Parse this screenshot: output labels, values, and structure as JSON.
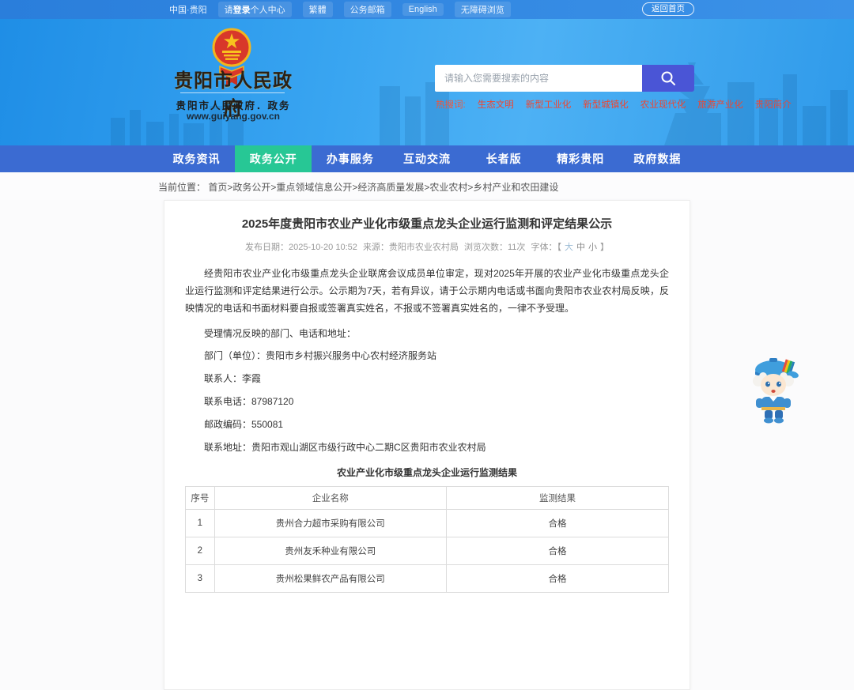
{
  "top_bar": {
    "region": "中国·贵阳",
    "login": {
      "prefix": "请",
      "bold": "登录",
      "suffix": "个人中心"
    },
    "traditional": "繁體",
    "mailbox": "公务邮箱",
    "english": "English",
    "accessibility": "无障碍浏览",
    "return_home": "返回首页"
  },
  "header": {
    "site_name": "贵阳市人民政府",
    "site_subtitle": "贵阳市人民政府．政务",
    "site_url": "www.guiyang.gov.cn",
    "search_placeholder": "请输入您需要搜索的内容",
    "hot_label": "热搜词:",
    "hot_words": [
      "生态文明",
      "新型工业化",
      "新型城镇化",
      "农业现代化",
      "旅游产业化",
      "贵阳简介"
    ]
  },
  "nav": {
    "tabs": [
      {
        "label": "政务资讯"
      },
      {
        "label": "政务公开"
      },
      {
        "label": "办事服务"
      },
      {
        "label": "互动交流"
      },
      {
        "label": "长者版"
      },
      {
        "label": "精彩贵阳"
      },
      {
        "label": "政府数据"
      }
    ],
    "active_tab": "政务公开"
  },
  "breadcrumb": {
    "label": "当前位置：",
    "path": "首页>政务公开>重点领域信息公开>经济高质量发展>农业农村>乡村产业和农田建设"
  },
  "article": {
    "title": "2025年度贵阳市农业产业化市级重点龙头企业运行监测和评定结果公示",
    "meta": {
      "publish": "发布日期：2025-10-20 10:52",
      "source": "来源：贵阳市农业农村局",
      "views": "浏览次数：11次",
      "font_label": "字体：【",
      "font_large": "大",
      "font_medium": "中",
      "font_small": "小",
      "font_close": "】"
    },
    "paragraph": "经贵阳市农业产业化市级重点龙头企业联席会议成员单位审定，现对2025年开展的农业产业化市级重点龙头企业运行监测和评定结果进行公示。公示期为7天，若有异议，请于公示期内电话或书面向贵阳市农业农村局反映，反映情况的电话和书面材料要自报或签署真实姓名，不报或不签署真实姓名的，一律不予受理。",
    "info_lines": [
      "受理情况反映的部门、电话和地址：",
      "部门（单位）：贵阳市乡村振兴服务中心农村经济服务站",
      "联系人：李霞",
      "联系电话：87987120",
      "邮政编码：550081",
      "联系地址：贵阳市观山湖区市级行政中心二期C区贵阳市农业农村局"
    ],
    "table_caption": "农业产业化市级重点龙头企业运行监测结果",
    "table": {
      "headers": [
        "序号",
        "企业名称",
        "监测结果"
      ],
      "rows": [
        {
          "seq": "1",
          "company": "贵州合力超市采购有限公司",
          "result": "合格"
        },
        {
          "seq": "2",
          "company": "贵州友禾种业有限公司",
          "result": "合格"
        },
        {
          "seq": "3",
          "company": "贵州松果鲜农产品有限公司",
          "result": "合格"
        }
      ]
    }
  },
  "colors": {
    "topbar_blue": "#2f87e0",
    "banner_blue": "#39a5f1",
    "nav_blue": "#3b6bd2",
    "active_tab_green": "#27c795",
    "search_button_purple": "#4a55d6",
    "hot_word_red": "#ee4631"
  }
}
